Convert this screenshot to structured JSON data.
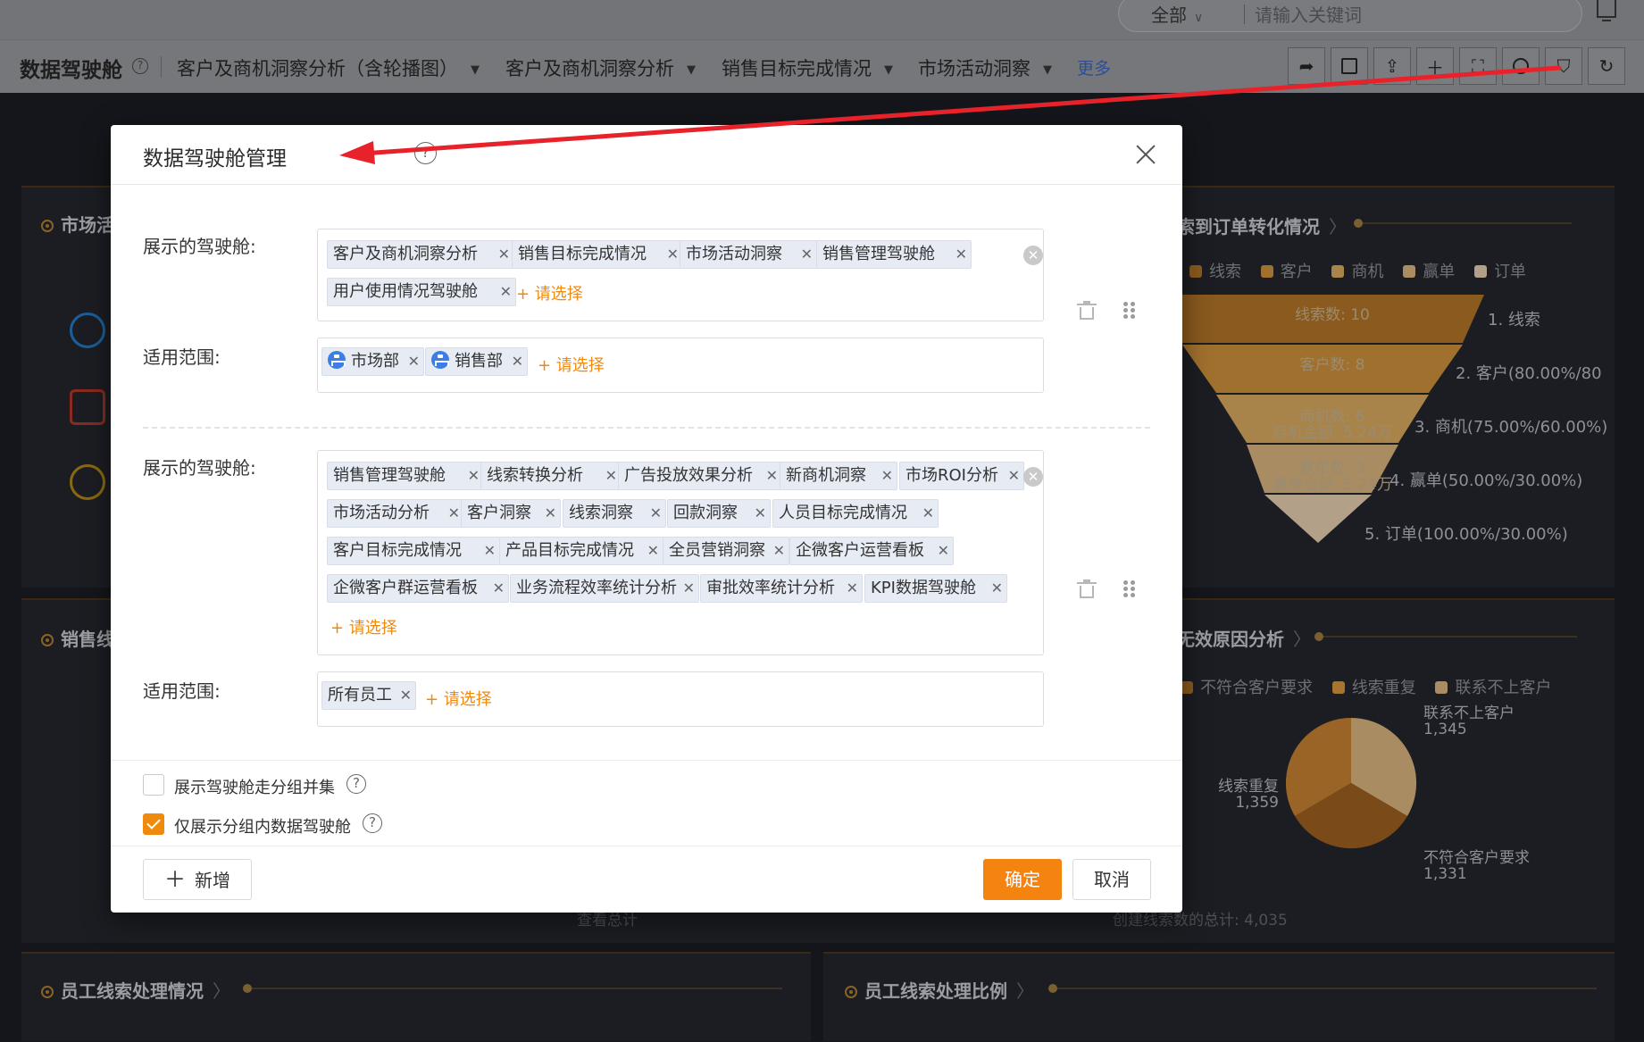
{
  "search": {
    "scope": "全部",
    "placeholder": "请输入关键词"
  },
  "nav": {
    "title": "数据驾驶舱",
    "tabs": [
      {
        "label": "客户及商机洞察分析（含轮播图）"
      },
      {
        "label": "客户及商机洞察分析"
      },
      {
        "label": "销售目标完成情况"
      },
      {
        "label": "市场活动洞察"
      }
    ],
    "more": "更多"
  },
  "background": {
    "panel_titles": {
      "market": "市场活",
      "funnel": "索到订单转化情况",
      "sales": "销售线",
      "reason": "无效原因分析",
      "emp_handle": "员工线索处理情况",
      "emp_ratio": "员工线索处理比例"
    },
    "funnel_legend": [
      "线索",
      "客户",
      "商机",
      "赢单",
      "订单"
    ],
    "funnel_inner": [
      "线索数: 10",
      "客户数: 8",
      "商机数: 6",
      "商机金额: 5.24万",
      "赢单数: 3",
      "赢单金额: 5.24万"
    ],
    "funnel_labels": [
      "1. 线索",
      "2. 客户(80.00%/80",
      "3. 商机(75.00%/60.00%)",
      "4. 赢单(50.00%/30.00%)",
      "5. 订单(100.00%/30.00%)"
    ],
    "reason_legend": [
      "不符合客户要求",
      "线索重复",
      "联系不上客户"
    ],
    "pie_labels": [
      {
        "name": "联系不上客户",
        "value": "1,345"
      },
      {
        "name": "线索重复",
        "value": "1,359"
      },
      {
        "name": "不符合客户要求",
        "value": "1,331"
      }
    ],
    "footnote_left": "查看总计",
    "footnote_right": "创建线索数的总计: 4,035",
    "colors": {
      "funnel1": "#8a5a1e",
      "funnel2": "#a0702e",
      "funnel3": "#a8844a",
      "funnel4": "#a98c62",
      "funnel5": "#b2a088"
    }
  },
  "modal": {
    "title": "数据驾驶舱管理",
    "groups": [
      {
        "display_label": "展示的驾驶舱:",
        "cockpits": [
          "客户及商机洞察分析",
          "销售目标完成情况",
          "市场活动洞察",
          "销售管理驾驶舱",
          "用户使用情况驾驶舱"
        ],
        "add_label": "+ 请选择",
        "scope_label": "适用范围:",
        "scopes": [
          "市场部",
          "销售部"
        ],
        "scope_add_label": "+ 请选择"
      },
      {
        "display_label": "展示的驾驶舱:",
        "cockpits": [
          "销售管理驾驶舱",
          "线索转换分析",
          "广告投放效果分析",
          "新商机洞察",
          "市场ROI分析",
          "市场活动分析",
          "客户洞察",
          "线索洞察",
          "回款洞察",
          "人员目标完成情况",
          "客户目标完成情况",
          "产品目标完成情况",
          "全员营销洞察",
          "企微客户运营看板",
          "企微客户群运营看板",
          "业务流程效率统计分析",
          "审批效率统计分析",
          "KPI数据驾驶舱"
        ],
        "add_label": "+ 请选择",
        "scope_label": "适用范围:",
        "scopes": [
          "所有员工"
        ],
        "scope_add_label": "+ 请选择"
      }
    ],
    "options": [
      {
        "label": "展示驾驶舱走分组并集",
        "checked": false
      },
      {
        "label": "仅展示分组内数据驾驶舱",
        "checked": true
      }
    ],
    "buttons": {
      "add": "新增",
      "confirm": "确定",
      "cancel": "取消"
    },
    "accent_color": "#f5830f",
    "annotation_color": "#e8222a"
  }
}
